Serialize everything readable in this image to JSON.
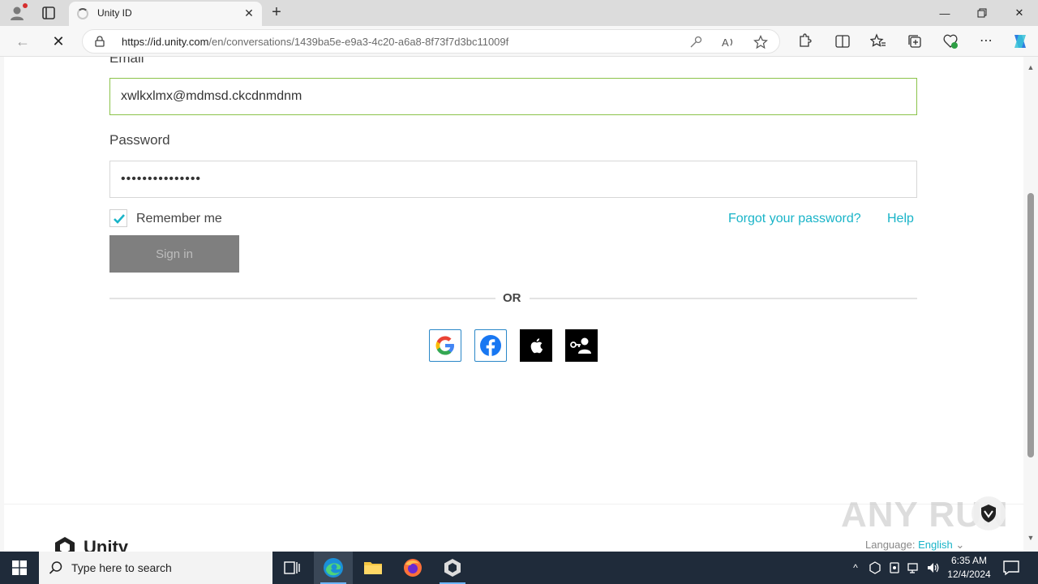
{
  "browser": {
    "tab_title": "Unity ID",
    "url_domain": "https://id.unity.com",
    "url_path": "/en/conversations/1439ba5e-e9a3-4c20-a6a8-8f73f7d3bc11009f"
  },
  "form": {
    "email_label": "Email",
    "email_value": "xwlkxlmx@mdmsd.ckcdnmdnm",
    "password_label": "Password",
    "password_value": "•••••••••••••••",
    "remember_label": "Remember me",
    "forgot_label": "Forgot your password?",
    "help_label": "Help",
    "signin_label": "Sign in",
    "or_label": "OR"
  },
  "footer": {
    "brand": "Unity",
    "language_label": "Language:",
    "language_value": "English"
  },
  "watermark": "ANY RUN",
  "taskbar": {
    "search_placeholder": "Type here to search",
    "time": "6:35 AM",
    "date": "12/4/2024"
  },
  "colors": {
    "accent": "#19b4c8",
    "valid_border": "#8bc34a",
    "signin_bg": "#7f7f7f",
    "taskbar_bg": "#1f2b3a"
  }
}
